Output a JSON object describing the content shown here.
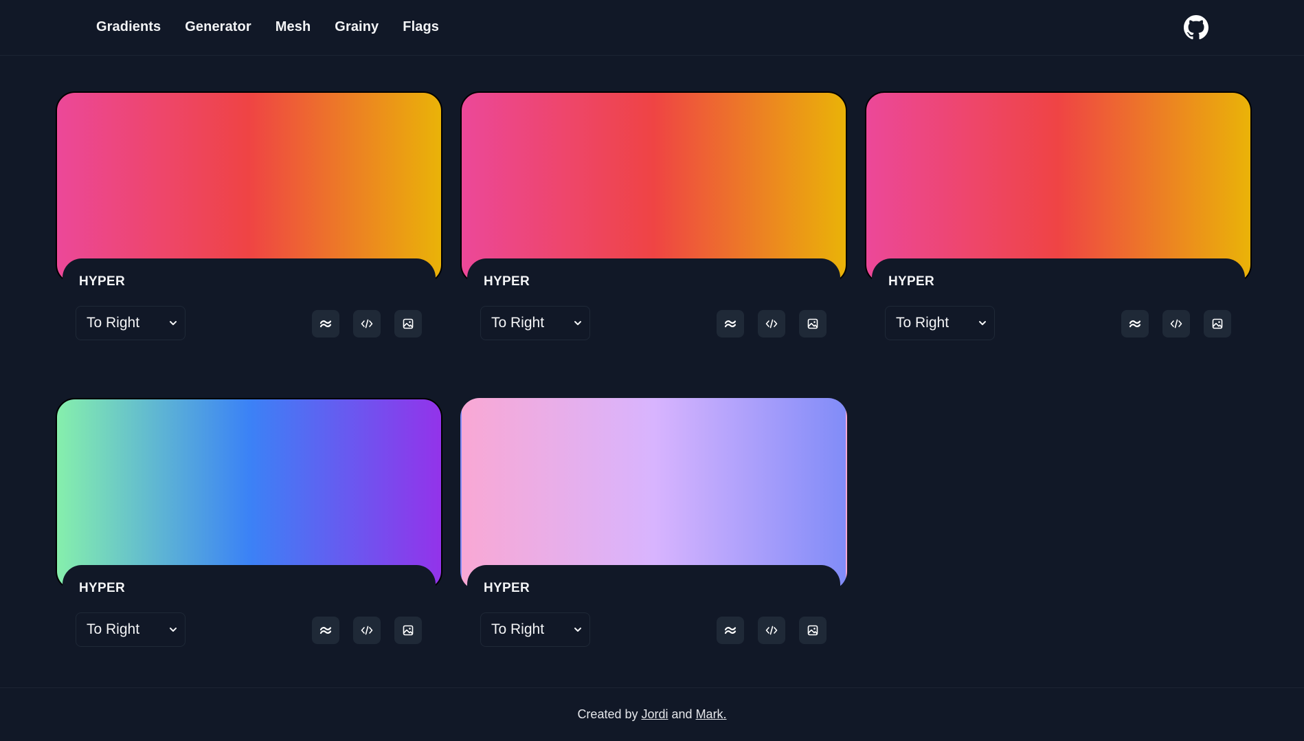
{
  "nav": {
    "items": [
      {
        "label": "Gradients"
      },
      {
        "label": "Generator"
      },
      {
        "label": "Mesh"
      },
      {
        "label": "Grainy"
      },
      {
        "label": "Flags"
      }
    ],
    "github_icon": "github-icon"
  },
  "cards": [
    {
      "title": "HYPER",
      "direction": "To Right",
      "colors": [
        "#ec4899",
        "#ef4444",
        "#eab308"
      ]
    },
    {
      "title": "HYPER",
      "direction": "To Right",
      "colors": [
        "#ec4899",
        "#ef4444",
        "#eab308"
      ]
    },
    {
      "title": "HYPER",
      "direction": "To Right",
      "colors": [
        "#ec4899",
        "#ef4444",
        "#eab308"
      ]
    },
    {
      "title": "HYPER",
      "direction": "To Right",
      "colors": [
        "#86efac",
        "#3b82f6",
        "#9333ea"
      ]
    },
    {
      "title": "HYPER",
      "direction": "To Right",
      "colors": [
        "#f9a8d4",
        "#d8b4fe",
        "#818cf8"
      ]
    }
  ],
  "card_icons": [
    "tailwind-icon",
    "code-icon",
    "image-icon"
  ],
  "footer": {
    "prefix": "Created by ",
    "author1": "Jordi",
    "middle": " and ",
    "author2": "Mark."
  },
  "colors": {
    "background": "#111827",
    "button_bg": "#1f2937",
    "text": "#f3f4f6"
  }
}
